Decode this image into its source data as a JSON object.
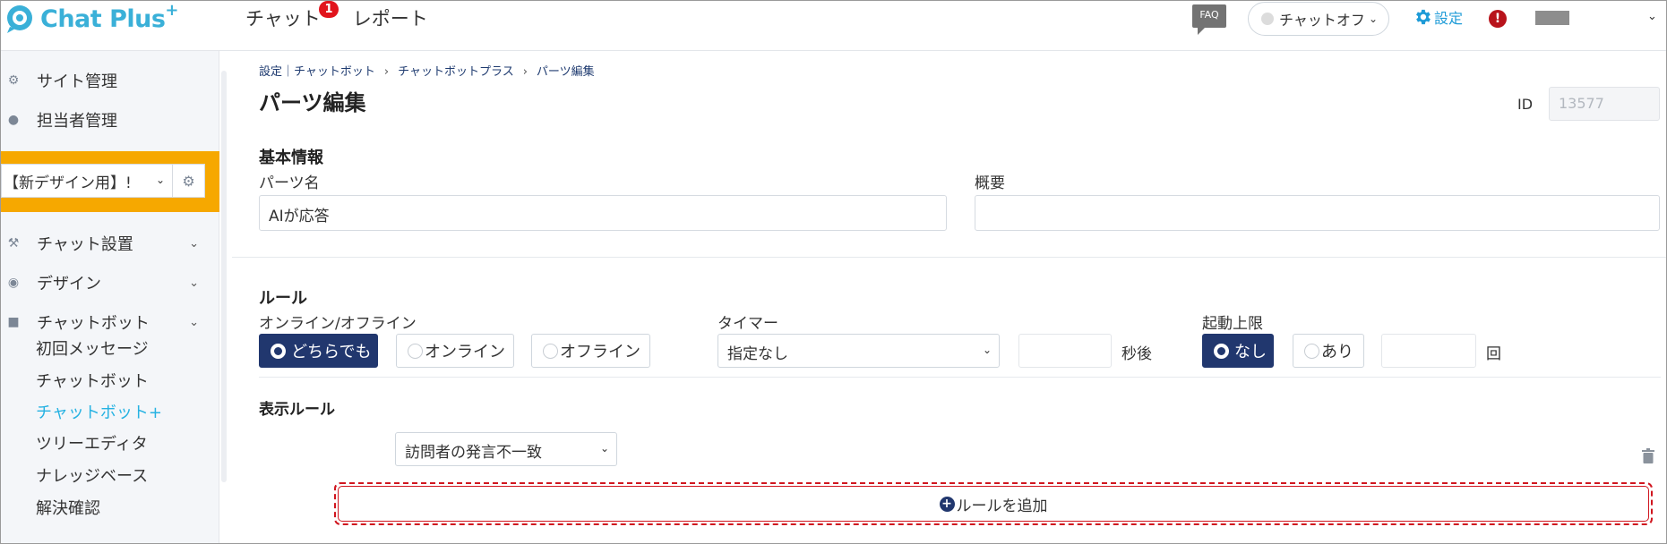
{
  "header": {
    "logo_text": "Chat Plus",
    "logo_sup": "+",
    "nav": [
      {
        "label": "チャット",
        "badge": "1"
      },
      {
        "label": "レポート"
      }
    ],
    "faq": "FAQ",
    "status": "チャットオフ",
    "settings": "設定",
    "alert": "!"
  },
  "sidebar": {
    "top_items": [
      "サイト管理",
      "担当者管理"
    ],
    "site_select": "【新デザイン用】!",
    "groups": [
      "チャット設置",
      "デザイン",
      "チャットボット"
    ],
    "sub_items": [
      "初回メッセージ",
      "チャットボット",
      "チャットボット+",
      "ツリーエディタ",
      "ナレッジベース",
      "解決確認"
    ],
    "active_sub": "チャットボット+"
  },
  "main": {
    "breadcrumb": [
      "設定｜チャットボット",
      "チャットボットプラス",
      "パーツ編集"
    ],
    "title": "パーツ編集",
    "id_label": "ID",
    "id_value": "13577",
    "basic": {
      "title": "基本情報",
      "name_label": "パーツ名",
      "name_value": "AIが応答",
      "summary_label": "概要",
      "summary_value": ""
    },
    "rules": {
      "title": "ルール",
      "online_label": "オンライン/オフライン",
      "online_options": [
        "どちらでも",
        "オンライン",
        "オフライン"
      ],
      "online_selected": "どちらでも",
      "timer_label": "タイマー",
      "timer_value": "指定なし",
      "seconds_suffix": "秒後",
      "limit_label": "起動上限",
      "limit_options": [
        "なし",
        "あり"
      ],
      "limit_selected": "なし",
      "times_suffix": "回"
    },
    "display": {
      "title": "表示ルール",
      "condition_value": "訪問者の発言不一致",
      "add_rule": "ルールを追加"
    }
  },
  "colors": {
    "brand": "#3ab0d8",
    "primary": "#21376e",
    "highlight": "#f6a800",
    "danger": "#d0161f",
    "active_link": "#26b2e2"
  }
}
